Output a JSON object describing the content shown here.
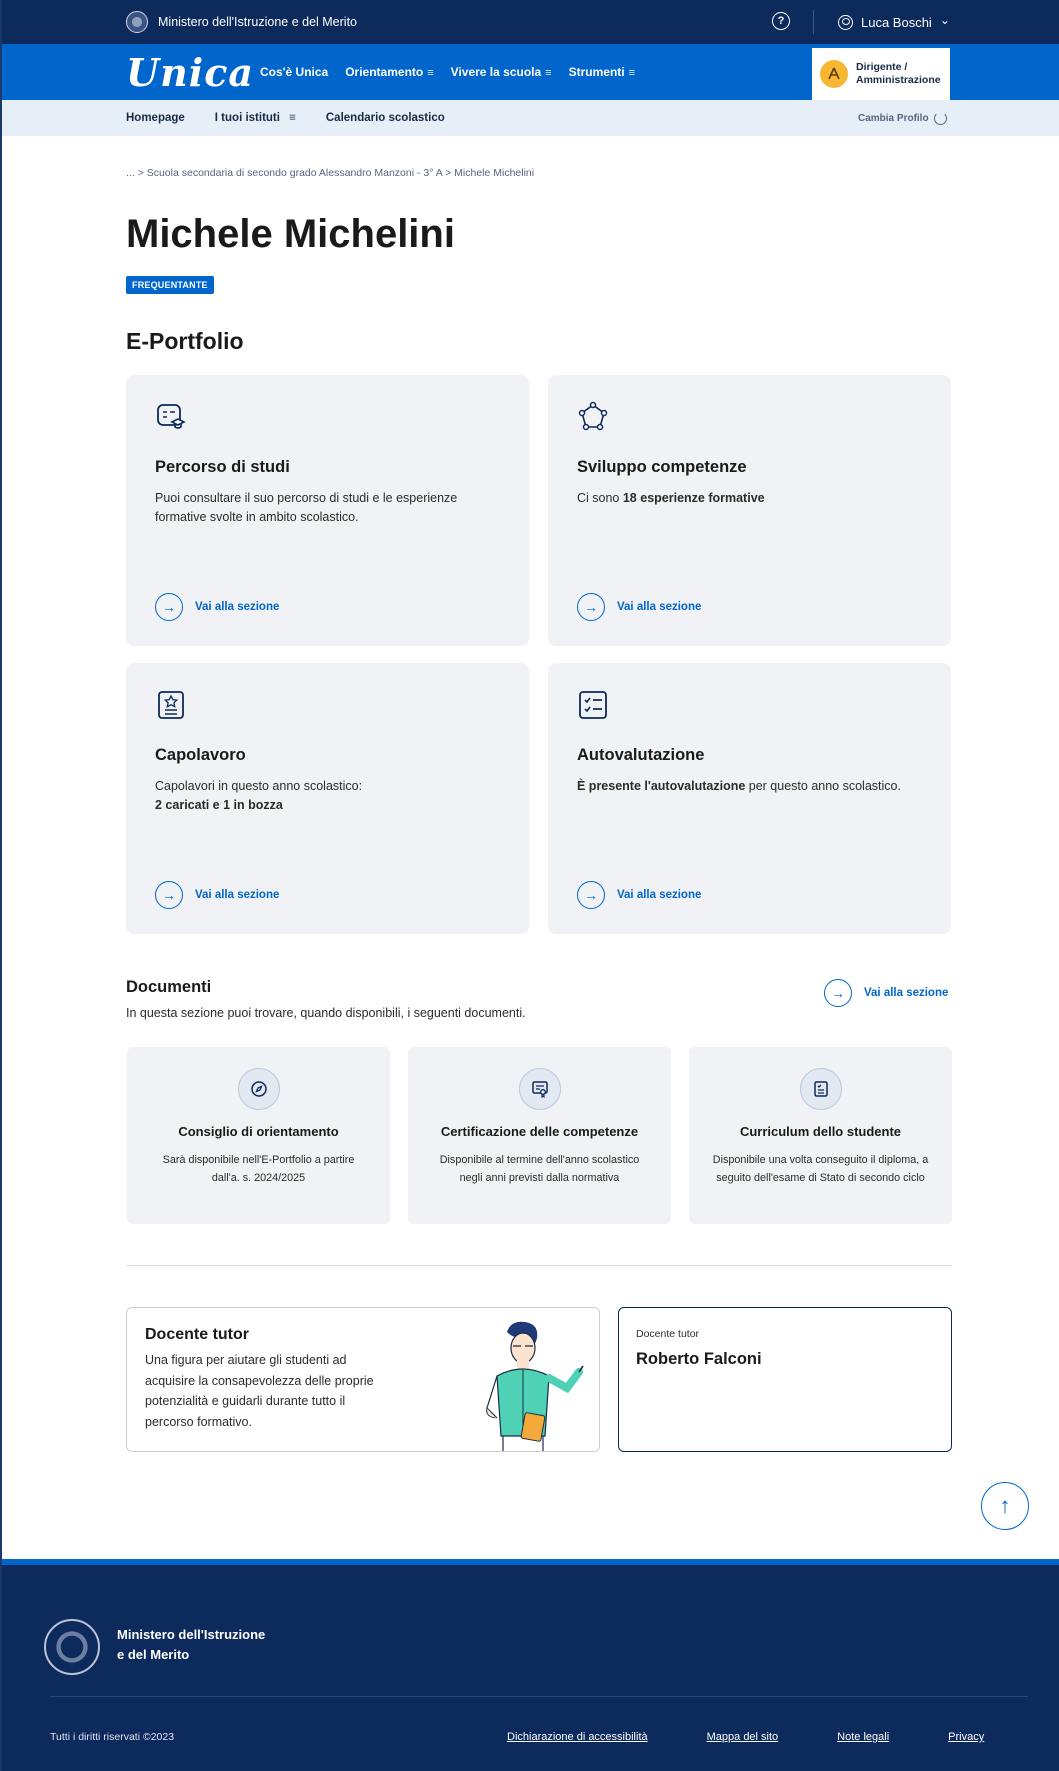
{
  "topbar": {
    "ministry": "Ministero dell'Istruzione e del Merito",
    "help_glyph": "?",
    "user_name": "Luca Boschi",
    "user_caret": "⌄"
  },
  "mainnav": {
    "logo": "Unica",
    "links": [
      {
        "label": "Cos'è Unica",
        "menu": false
      },
      {
        "label": "Orientamento",
        "menu": true
      },
      {
        "label": "Vivere la scuola",
        "menu": true
      },
      {
        "label": "Strumenti",
        "menu": true
      }
    ],
    "burger": "≡",
    "profile_line1": "Dirigente /",
    "profile_line2": "Amministrazione"
  },
  "subnav": {
    "items": [
      "Homepage",
      "I tuoi istituti",
      "Calendario scolastico"
    ],
    "istituti_burger": "≡",
    "change_profile": "Cambia Profilo"
  },
  "breadcrumb": "... > Scuola secondaria di secondo grado Alessandro Manzoni - 3° A > Michele Michelini",
  "student": {
    "name": "Michele Michelini",
    "status": "FREQUENTANTE"
  },
  "portfolio": {
    "heading": "E-Portfolio",
    "cards": [
      {
        "title": "Percorso di studi",
        "text": "Puoi consultare il suo percorso di studi e le esperienze formative svolte in ambito scolastico.",
        "link": "Vai alla sezione",
        "icon": "study-path-icon"
      },
      {
        "title": "Sviluppo competenze",
        "text_pre": "Ci sono ",
        "text_bold": "18 esperienze formative",
        "link": "Vai alla sezione",
        "icon": "competence-icon"
      },
      {
        "title": "Capolavoro",
        "text_pre": "Capolavori in questo anno scolastico:",
        "text_bold": "2 caricati e 1 in bozza",
        "link": "Vai alla sezione",
        "icon": "masterpiece-icon"
      },
      {
        "title": "Autovalutazione",
        "text_bold": "È presente l'autovalutazione",
        "text_post": " per questo anno scolastico.",
        "link": "Vai alla sezione",
        "icon": "checklist-icon"
      }
    ]
  },
  "documents": {
    "heading": "Documenti",
    "subtitle": "In questa sezione puoi trovare, quando disponibili, i seguenti documenti.",
    "link": "Vai alla sezione",
    "items": [
      {
        "title": "Consiglio di orientamento",
        "text": "Sarà disponibile nell'E-Portfolio a partire dall'a. s. 2024/2025",
        "icon": "compass-icon"
      },
      {
        "title": "Certificazione delle competenze",
        "text": "Disponibile al termine dell'anno scolastico negli anni previsti dalla normativa",
        "icon": "certificate-icon"
      },
      {
        "title": "Curriculum dello studente",
        "text": "Disponibile una volta conseguito il diploma, a seguito dell'esame di Stato di secondo ciclo",
        "icon": "curriculum-icon"
      }
    ]
  },
  "tutor": {
    "heading": "Docente tutor",
    "text": "Una figura per aiutare gli studenti ad acquisire la consapevolezza delle proprie potenzialità e guidarli durante tutto il percorso formativo.",
    "label": "Docente tutor",
    "name": "Roberto Falconi"
  },
  "footer": {
    "ministry_line1": "Ministero dell'Istruzione",
    "ministry_line2": "e del Merito",
    "copyright": "Tutti i diritti riservati ©2023",
    "links": [
      "Dichiarazione di accessibilità",
      "Mappa del sito",
      "Note legali",
      "Privacy"
    ]
  },
  "colors": {
    "primary": "#0066cc",
    "dark_blue": "#0c2a5b",
    "card_bg": "#f0f2f5",
    "profile_accent": "#f7b733"
  }
}
